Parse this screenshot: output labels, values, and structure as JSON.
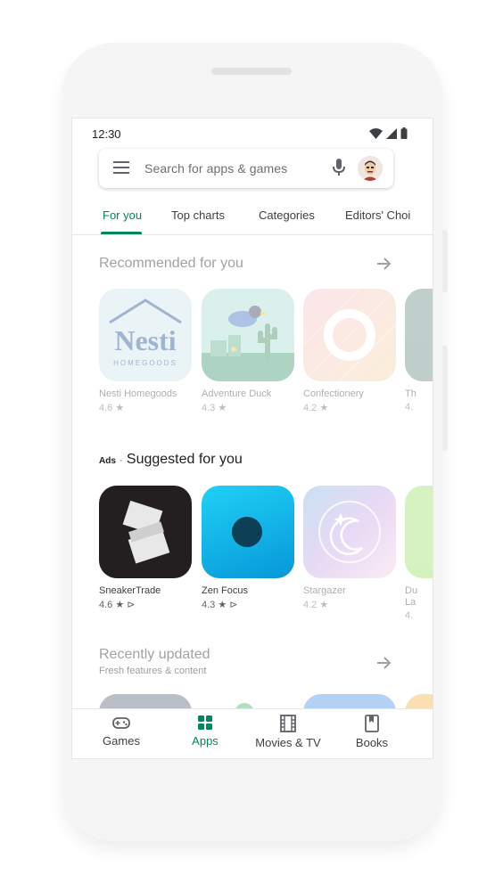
{
  "status_bar": {
    "time": "12:30"
  },
  "search": {
    "placeholder": "Search for apps & games"
  },
  "tabs": [
    {
      "label": "For you",
      "active": true
    },
    {
      "label": "Top charts",
      "active": false
    },
    {
      "label": "Categories",
      "active": false
    },
    {
      "label": "Editors' Choi",
      "active": false
    }
  ],
  "recommended": {
    "title": "Recommended for you",
    "apps": [
      {
        "name": "Nesti Homegoods",
        "rating": "4.6",
        "icon_text": "Nesti",
        "icon_subtext": "HOMEGOODS"
      },
      {
        "name": "Adventure Duck",
        "rating": "4.3"
      },
      {
        "name": "Confectionery",
        "rating": "4.2"
      },
      {
        "name": "Th",
        "rating": "4."
      }
    ]
  },
  "suggested": {
    "ads_label": "Ads",
    "separator": "·",
    "title": "Suggested for you",
    "apps": [
      {
        "name": "SneakerTrade",
        "rating": "4.6"
      },
      {
        "name": "Zen Focus",
        "rating": "4.3"
      },
      {
        "name": "Stargazer",
        "rating": "4.2"
      },
      {
        "name": "Du",
        "name_line2": "La",
        "rating": "4."
      }
    ]
  },
  "recently_updated": {
    "title": "Recently updated",
    "subtitle": "Fresh features & content"
  },
  "bottom_nav": [
    {
      "label": "Games",
      "icon": "gamepad-icon",
      "active": false
    },
    {
      "label": "Apps",
      "icon": "apps-grid-icon",
      "active": true
    },
    {
      "label": "Movies & TV",
      "icon": "film-icon",
      "active": false
    },
    {
      "label": "Books",
      "icon": "book-icon",
      "active": false
    }
  ],
  "colors": {
    "accent": "#01875f",
    "text_primary": "#202124",
    "text_secondary": "#5f6368"
  }
}
